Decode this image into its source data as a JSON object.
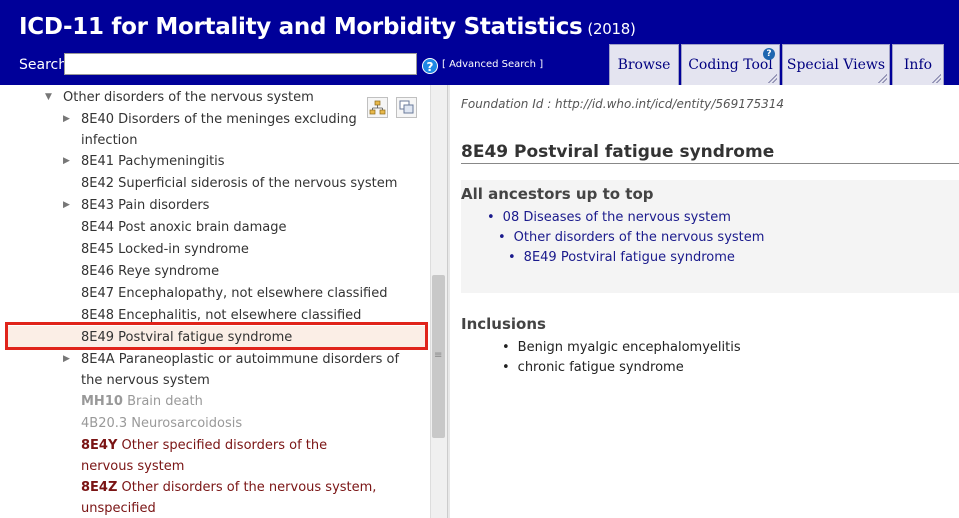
{
  "header": {
    "title": "ICD-11 for Mortality and Morbidity Statistics",
    "year": "(2018)",
    "search_label": "Search",
    "search_value": "",
    "help_icon": "?",
    "advanced_search": "[ Advanced Search ]",
    "bg_color": "#000099"
  },
  "tabs": [
    {
      "label": "Browse"
    },
    {
      "label": "Coding Tool",
      "badge": "?"
    },
    {
      "label": "Special Views"
    },
    {
      "label": "Info"
    }
  ],
  "tree": {
    "parent": {
      "label": "Other disorders of the nervous system",
      "arrow": "▼"
    },
    "items": [
      {
        "code": "8E40",
        "label": "Disorders of the meninges excluding infection",
        "arrow": "▶"
      },
      {
        "code": "8E41",
        "label": "Pachymeningitis",
        "arrow": "▶"
      },
      {
        "code": "8E42",
        "label": "Superficial siderosis of the nervous system",
        "arrow": ""
      },
      {
        "code": "8E43",
        "label": "Pain disorders",
        "arrow": "▶"
      },
      {
        "code": "8E44",
        "label": "Post anoxic brain damage",
        "arrow": ""
      },
      {
        "code": "8E45",
        "label": "Locked-in syndrome",
        "arrow": ""
      },
      {
        "code": "8E46",
        "label": "Reye syndrome",
        "arrow": ""
      },
      {
        "code": "8E47",
        "label": "Encephalopathy, not elsewhere classified",
        "arrow": ""
      },
      {
        "code": "8E48",
        "label": "Encephalitis, not elsewhere classified",
        "arrow": ""
      },
      {
        "code": "8E49",
        "label": "Postviral fatigue syndrome",
        "arrow": "",
        "selected": true
      },
      {
        "code": "8E4A",
        "label": "Paraneoplastic or autoimmune disorders of the nervous system",
        "arrow": "▶"
      },
      {
        "code": "MH10",
        "label": "Brain death",
        "arrow": "",
        "style": "grey"
      },
      {
        "code": "4B20.3",
        "label": "Neurosarcoidosis",
        "arrow": "",
        "style": "grey"
      },
      {
        "code": "8E4Y",
        "label": "Other specified disorders of the nervous system",
        "arrow": "",
        "style": "maroon"
      },
      {
        "code": "8E4Z",
        "label": "Other disorders of the nervous system, unspecified",
        "arrow": "",
        "style": "maroon"
      }
    ]
  },
  "detail": {
    "foundation_id": "Foundation Id : http://id.who.int/icd/entity/569175314",
    "title": "8E49 Postviral fatigue syndrome",
    "ancestors_heading": "All ancestors up to top",
    "ancestors": [
      "08 Diseases of the nervous system",
      "Other disorders of the nervous system",
      "8E49 Postviral fatigue syndrome"
    ],
    "inclusions_heading": "Inclusions",
    "inclusions": [
      "Benign myalgic encephalomyelitis",
      "chronic fatigue syndrome"
    ]
  },
  "colors": {
    "highlight_border": "#e0241b",
    "selected_bg": "#fbeee6",
    "link": "#1a1a8c",
    "maroon": "#7a1414"
  }
}
